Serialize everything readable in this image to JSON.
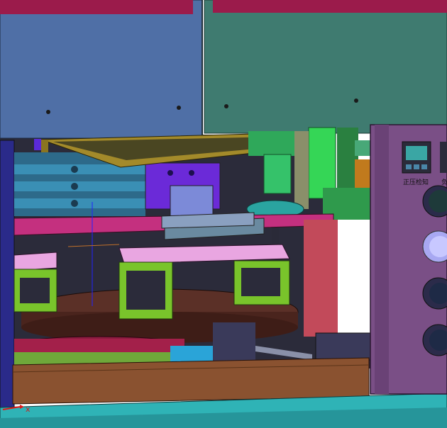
{
  "viewport": {
    "control_panel": {
      "indicator_label": "正压检知",
      "indicator_label_cut": "负",
      "buttons": [
        "start",
        "reset",
        "stop",
        "emergency"
      ]
    },
    "axis_triad": {
      "x_label": "x"
    },
    "colors": {
      "background": "#ffffff",
      "upper_panel_left": "#4f6fa6",
      "upper_panel_right": "#3f7b70",
      "magenta_bar": "#c4307f",
      "control_cabinet": "#7a4f86",
      "turntable": "#5b3027",
      "fixture_green": "#79c42b",
      "fixture_plate": "#e9a6e1",
      "base_frame": "#8a5230",
      "floor_cyan": "#2fb3b6",
      "tray_gold": "#a38a2a"
    }
  }
}
